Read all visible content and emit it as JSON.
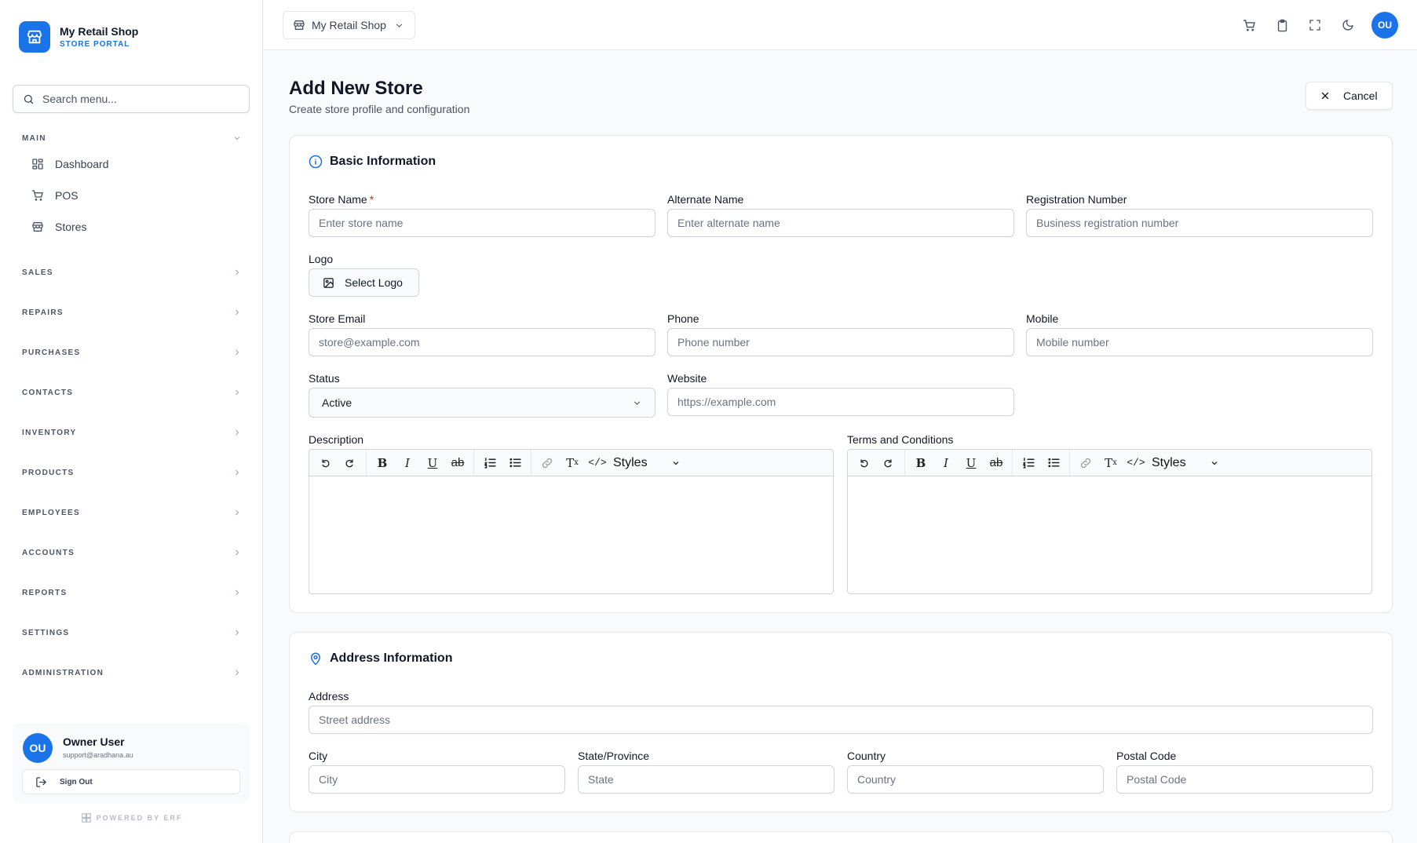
{
  "brand": {
    "name": "My Retail Shop",
    "subtitle": "STORE PORTAL"
  },
  "sidebar": {
    "search_placeholder": "Search menu...",
    "main_section": "MAIN",
    "main_items": [
      {
        "label": "Dashboard",
        "icon": "dashboard-icon"
      },
      {
        "label": "POS",
        "icon": "cart-icon"
      },
      {
        "label": "Stores",
        "icon": "store-icon"
      }
    ],
    "sections": [
      "SALES",
      "REPAIRS",
      "PURCHASES",
      "CONTACTS",
      "INVENTORY",
      "PRODUCTS",
      "EMPLOYEES",
      "ACCOUNTS",
      "REPORTS",
      "SETTINGS",
      "ADMINISTRATION"
    ],
    "user": {
      "initials": "OU",
      "name": "Owner User",
      "email": "support@aradhana.au"
    },
    "signout_label": "Sign Out",
    "powered_by": "POWERED BY ERF"
  },
  "topbar": {
    "store_selector": "My Retail Shop",
    "icons": [
      "cart-icon",
      "clipboard-icon",
      "fullscreen-icon",
      "moon-icon"
    ],
    "avatar_initials": "OU"
  },
  "page": {
    "title": "Add New Store",
    "subtitle": "Create store profile and configuration",
    "cancel_label": "Cancel"
  },
  "basic": {
    "title": "Basic Information",
    "store_name": {
      "label": "Store Name",
      "required_mark": "*",
      "placeholder": "Enter store name"
    },
    "alternate_name": {
      "label": "Alternate Name",
      "placeholder": "Enter alternate name"
    },
    "registration": {
      "label": "Registration Number",
      "placeholder": "Business registration number"
    },
    "logo": {
      "label": "Logo",
      "button": "Select Logo"
    },
    "email": {
      "label": "Store Email",
      "placeholder": "store@example.com"
    },
    "phone": {
      "label": "Phone",
      "placeholder": "Phone number"
    },
    "mobile": {
      "label": "Mobile",
      "placeholder": "Mobile number"
    },
    "status": {
      "label": "Status",
      "value": "Active"
    },
    "website": {
      "label": "Website",
      "placeholder": "https://example.com"
    },
    "description_label": "Description",
    "terms_label": "Terms and Conditions",
    "editor_styles_label": "Styles",
    "editor_buttons": {
      "bold": "B",
      "italic": "I",
      "underline": "U",
      "strike": "ab",
      "clear": "Tx",
      "code": "</>"
    }
  },
  "address": {
    "title": "Address Information",
    "street": {
      "label": "Address",
      "placeholder": "Street address"
    },
    "city": {
      "label": "City",
      "placeholder": "City"
    },
    "state": {
      "label": "State/Province",
      "placeholder": "State"
    },
    "country": {
      "label": "Country",
      "placeholder": "Country"
    },
    "postal": {
      "label": "Postal Code",
      "placeholder": "Postal Code"
    }
  },
  "colors": {
    "accent": "#1a73e8",
    "required": "#dc2626",
    "border": "#d1d5db"
  }
}
